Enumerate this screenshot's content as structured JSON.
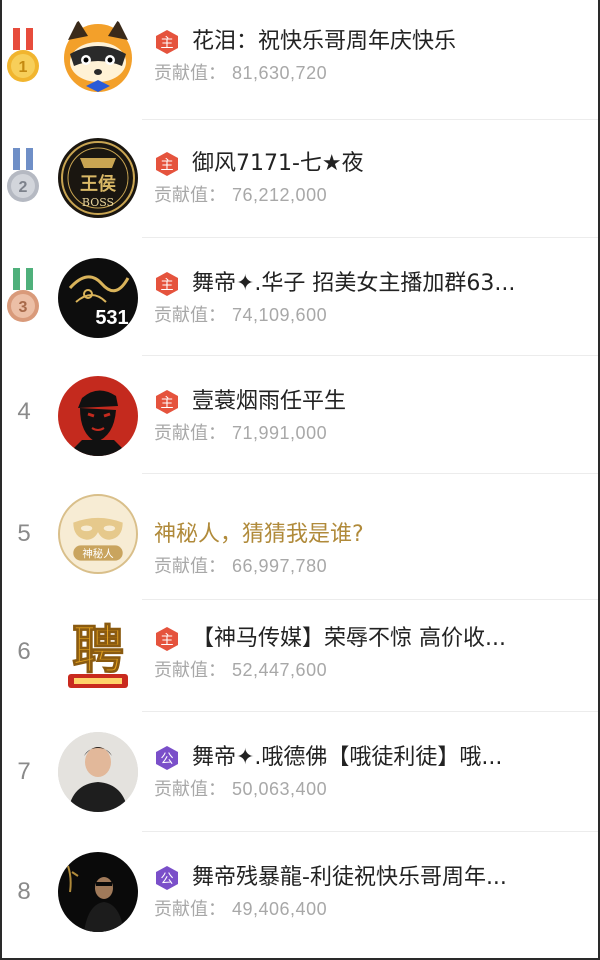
{
  "leaderboard": {
    "contribution_label": "贡献值：",
    "entries": [
      {
        "rank": "1",
        "name": "花泪：祝快乐哥周年庆快乐",
        "value": "81,630,720",
        "badge": "主",
        "badge_color": "#e5533d",
        "medal_color": "#f1b52e",
        "ribbon_color": "#e74c3c"
      },
      {
        "rank": "2",
        "name": "御风7171-七★夜",
        "value": "76,212,000",
        "badge": "主",
        "badge_color": "#e5533d",
        "medal_color": "#b5b9c2",
        "ribbon_color": "#6f8fc7",
        "avatar_text": "BOSS"
      },
      {
        "rank": "3",
        "name": "舞帝✦.华子 招美女主播加群63...",
        "value": "74,109,600",
        "badge": "主",
        "badge_color": "#e5533d",
        "medal_color": "#d99a7a",
        "ribbon_color": "#4fb07b",
        "avatar_text": "531"
      },
      {
        "rank": "4",
        "name": "壹蓑烟雨任平生",
        "value": "71,991,000",
        "badge": "主",
        "badge_color": "#e5533d"
      },
      {
        "rank": "5",
        "name": "神秘人，猜猜我是谁?",
        "value": "66,997,780",
        "avatar_text": "神秘人"
      },
      {
        "rank": "6",
        "name": "【神马传媒】荣辱不惊 高价收...",
        "value": "52,447,600",
        "badge": "主",
        "badge_color": "#e5533d",
        "avatar_text": "聘"
      },
      {
        "rank": "7",
        "name": "舞帝✦.哦德佛【哦徒利徒】哦...",
        "value": "50,063,400",
        "badge": "公",
        "badge_color": "#7a4fc9"
      },
      {
        "rank": "8",
        "name": "舞帝残暴龍-利徒祝快乐哥周年...",
        "value": "49,406,400",
        "badge": "公",
        "badge_color": "#7a4fc9"
      }
    ]
  }
}
